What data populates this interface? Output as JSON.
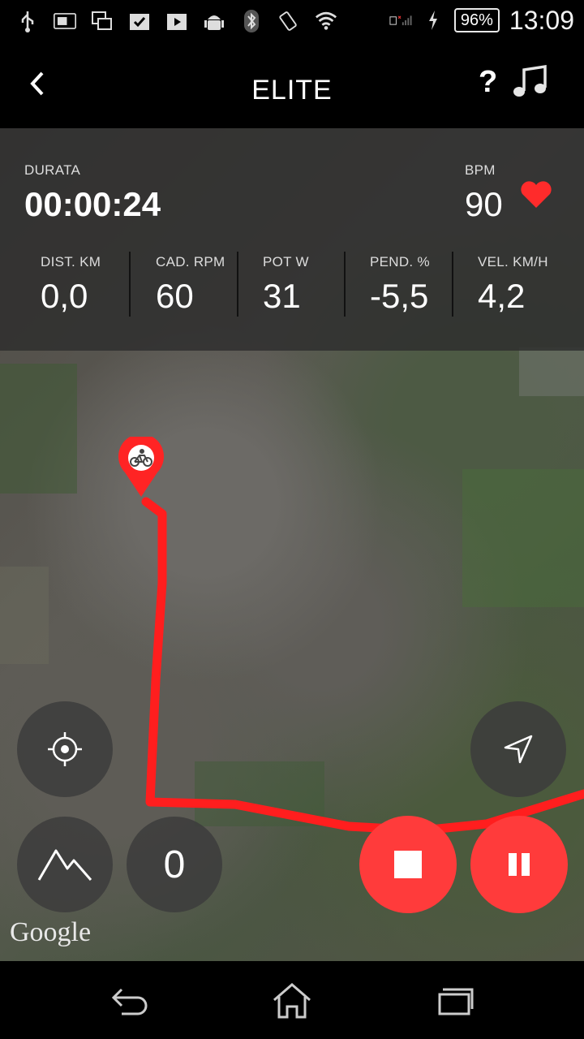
{
  "status_bar": {
    "battery": "96%",
    "time": "13:09"
  },
  "header": {
    "title": "ELITE",
    "help": "?",
    "back_icon": "back-arrow-icon",
    "music_icon": "music-note-icon"
  },
  "summary": {
    "duration_label": "DURATA",
    "duration_value": "00:00:24",
    "bpm_label": "BPM",
    "bpm_value": "90",
    "heart_color": "#ff2b2b"
  },
  "metrics": [
    {
      "label": "DIST. KM",
      "value": "0,0"
    },
    {
      "label": "CAD. RPM",
      "value": "60"
    },
    {
      "label": "POT W",
      "value": "31"
    },
    {
      "label": "PEND. %",
      "value": "-5,5"
    },
    {
      "label": "VEL. KM/H",
      "value": "4,2"
    }
  ],
  "map": {
    "route_color": "#ff1e1e",
    "attribution": "Google",
    "marker_icon": "bicycle-icon"
  },
  "controls": {
    "counter": "0",
    "accent": "#ff3b3b"
  }
}
